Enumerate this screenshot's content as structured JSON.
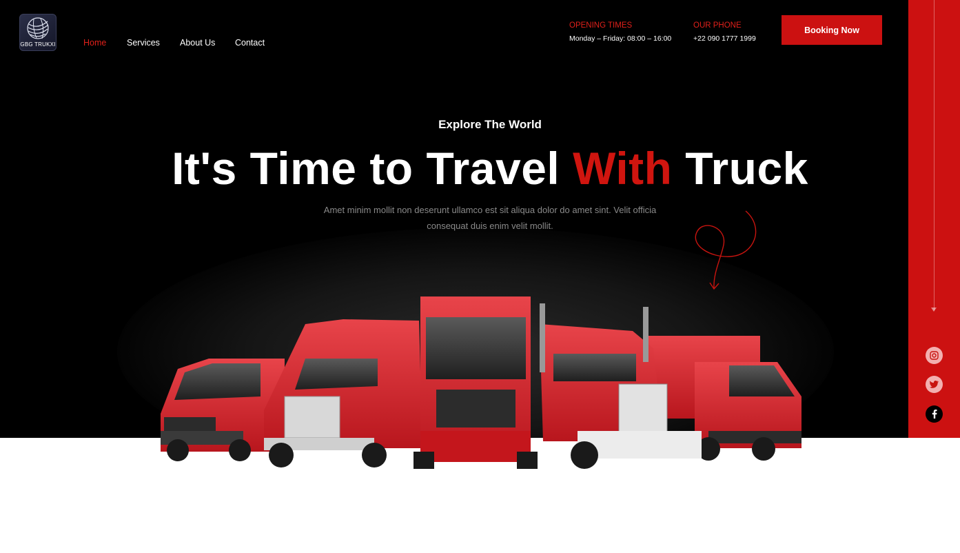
{
  "brand": {
    "logo_text": "GBG TRUKXI"
  },
  "nav": {
    "items": [
      {
        "label": "Home",
        "active": true
      },
      {
        "label": "Services",
        "active": false
      },
      {
        "label": "About Us",
        "active": false
      },
      {
        "label": "Contact",
        "active": false
      }
    ]
  },
  "header": {
    "opening": {
      "title": "OPENING TIMES",
      "text": "Monday – Friday: 08:00 – 16:00"
    },
    "phone": {
      "title": "OUR PHONE",
      "text": "+22 090 1777 1999"
    },
    "booking_label": "Booking Now"
  },
  "hero": {
    "eyebrow": "Explore The World",
    "headline_before": "It's Time to Travel ",
    "headline_accent": "With",
    "headline_after": " Truck",
    "subtitle": "Amet minim mollit non deserunt ullamco est sit aliqua dolor do amet sint. Velit officia consequat duis enim velit mollit."
  },
  "social": {
    "icons": [
      "instagram-icon",
      "twitter-icon",
      "facebook-icon"
    ]
  },
  "colors": {
    "accent": "#cc1111",
    "hero_bg": "#000000",
    "sidebar": "#cc1111"
  }
}
